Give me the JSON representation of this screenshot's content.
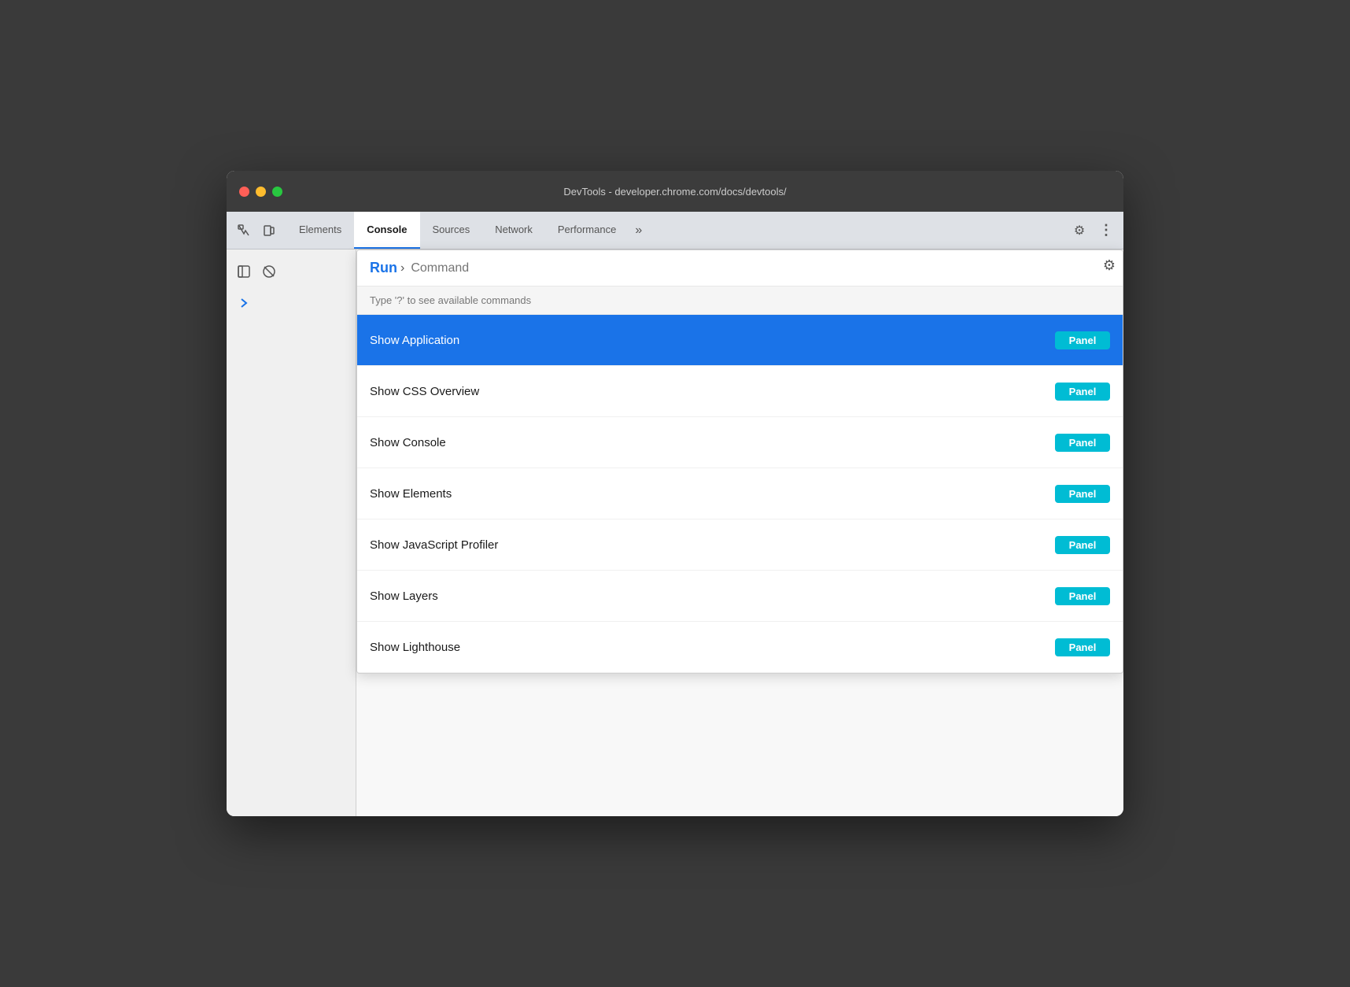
{
  "window": {
    "title": "DevTools - developer.chrome.com/docs/devtools/"
  },
  "traffic_lights": {
    "close": "close",
    "minimize": "minimize",
    "maximize": "maximize"
  },
  "tabs": [
    {
      "label": "Elements",
      "active": false
    },
    {
      "label": "Console",
      "active": true
    },
    {
      "label": "Sources",
      "active": false
    },
    {
      "label": "Network",
      "active": false
    },
    {
      "label": "Performance",
      "active": false
    }
  ],
  "tab_more_label": "»",
  "toolbar": {
    "gear_icon": "⚙",
    "dots_icon": "⋮"
  },
  "command_menu": {
    "run_label": "Run",
    "chevron": "›",
    "input_placeholder": "Command",
    "hint": "Type '?' to see available commands",
    "items": [
      {
        "name": "Show Application",
        "badge": "Panel",
        "selected": true
      },
      {
        "name": "Show CSS Overview",
        "badge": "Panel",
        "selected": false
      },
      {
        "name": "Show Console",
        "badge": "Panel",
        "selected": false
      },
      {
        "name": "Show Elements",
        "badge": "Panel",
        "selected": false
      },
      {
        "name": "Show JavaScript Profiler",
        "badge": "Panel",
        "selected": false
      },
      {
        "name": "Show Layers",
        "badge": "Panel",
        "selected": false
      },
      {
        "name": "Show Lighthouse",
        "badge": "Panel",
        "selected": false
      }
    ]
  },
  "sidebar": {
    "icon1": "▶",
    "icon2": "›"
  },
  "colors": {
    "selected_bg": "#1a73e8",
    "badge_bg": "#00bcd4",
    "tab_active_border": "#1a73e8"
  }
}
